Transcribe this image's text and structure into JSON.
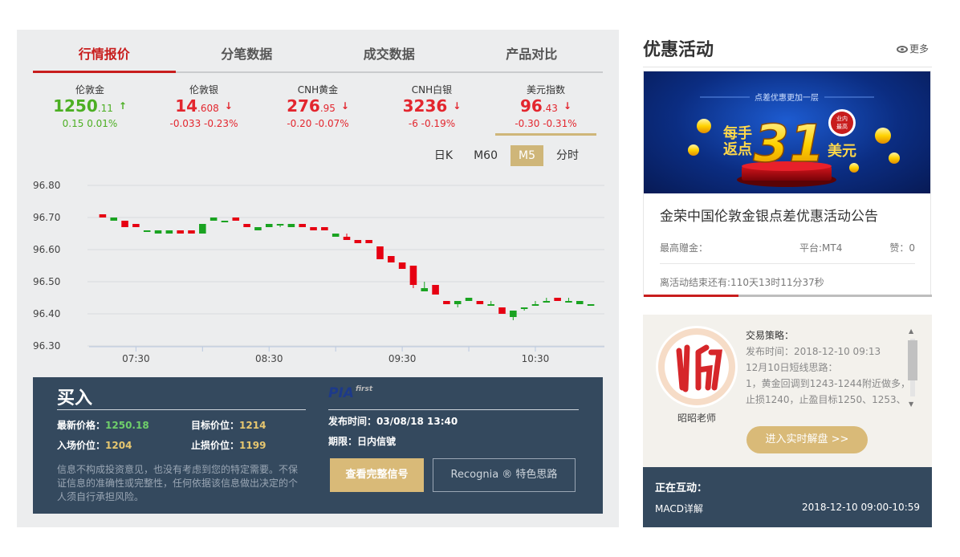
{
  "tabs": [
    "行情报价",
    "分笔数据",
    "成交数据",
    "产品对比"
  ],
  "quotes": [
    {
      "name": "伦敦金",
      "price_int": "1250",
      "price_dec": ".11",
      "arrow": "↑",
      "change": "0.15  0.01%",
      "dir": "up"
    },
    {
      "name": "伦敦银",
      "price_int": "14",
      "price_dec": ".608",
      "arrow": "↓",
      "change": "-0.033  -0.23%",
      "dir": "down"
    },
    {
      "name": "CNH黄金",
      "price_int": "276",
      "price_dec": ".95",
      "arrow": "↓",
      "change": "-0.20  -0.07%",
      "dir": "down"
    },
    {
      "name": "CNH白银",
      "price_int": "3236",
      "price_dec": "",
      "arrow": "↓",
      "change": "-6  -0.19%",
      "dir": "down"
    },
    {
      "name": "美元指数",
      "price_int": "96",
      "price_dec": ".43",
      "arrow": "↓",
      "change": "-0.30  -0.31%",
      "dir": "down"
    }
  ],
  "periods": [
    "日K",
    "M60",
    "M5",
    "分时"
  ],
  "active_period": "M5",
  "chart_data": {
    "type": "candlestick",
    "title": "",
    "ylim": [
      96.3,
      96.8
    ],
    "yticks": [
      "96.80",
      "96.70",
      "96.60",
      "96.50",
      "96.40",
      "96.30"
    ],
    "xticks": [
      "07:30",
      "08:30",
      "09:30",
      "10:30"
    ],
    "up_color": "#1aa321",
    "down_color": "#e60012",
    "candles": [
      {
        "o": 96.71,
        "c": 96.7,
        "h": 96.71,
        "l": 96.7
      },
      {
        "o": 96.69,
        "c": 96.7,
        "h": 96.7,
        "l": 96.69
      },
      {
        "o": 96.69,
        "c": 96.67,
        "h": 96.69,
        "l": 96.67
      },
      {
        "o": 96.68,
        "c": 96.67,
        "h": 96.68,
        "l": 96.67
      },
      {
        "o": 96.66,
        "c": 96.66,
        "h": 96.66,
        "l": 96.66
      },
      {
        "o": 96.65,
        "c": 96.66,
        "h": 96.66,
        "l": 96.65
      },
      {
        "o": 96.65,
        "c": 96.66,
        "h": 96.66,
        "l": 96.65
      },
      {
        "o": 96.66,
        "c": 96.65,
        "h": 96.66,
        "l": 96.65
      },
      {
        "o": 96.66,
        "c": 96.65,
        "h": 96.66,
        "l": 96.65
      },
      {
        "o": 96.65,
        "c": 96.68,
        "h": 96.68,
        "l": 96.65
      },
      {
        "o": 96.69,
        "c": 96.7,
        "h": 96.7,
        "l": 96.69
      },
      {
        "o": 96.69,
        "c": 96.69,
        "h": 96.69,
        "l": 96.69
      },
      {
        "o": 96.7,
        "c": 96.69,
        "h": 96.7,
        "l": 96.69
      },
      {
        "o": 96.68,
        "c": 96.67,
        "h": 96.68,
        "l": 96.67
      },
      {
        "o": 96.66,
        "c": 96.67,
        "h": 96.67,
        "l": 96.66
      },
      {
        "o": 96.67,
        "c": 96.68,
        "h": 96.68,
        "l": 96.67
      },
      {
        "o": 96.68,
        "c": 96.68,
        "h": 96.68,
        "l": 96.67
      },
      {
        "o": 96.67,
        "c": 96.68,
        "h": 96.68,
        "l": 96.67
      },
      {
        "o": 96.68,
        "c": 96.67,
        "h": 96.68,
        "l": 96.67
      },
      {
        "o": 96.67,
        "c": 96.66,
        "h": 96.67,
        "l": 96.66
      },
      {
        "o": 96.67,
        "c": 96.66,
        "h": 96.67,
        "l": 96.66
      },
      {
        "o": 96.64,
        "c": 96.65,
        "h": 96.65,
        "l": 96.64
      },
      {
        "o": 96.64,
        "c": 96.63,
        "h": 96.65,
        "l": 96.63
      },
      {
        "o": 96.63,
        "c": 96.62,
        "h": 96.63,
        "l": 96.62
      },
      {
        "o": 96.63,
        "c": 96.62,
        "h": 96.63,
        "l": 96.62
      },
      {
        "o": 96.61,
        "c": 96.57,
        "h": 96.61,
        "l": 96.57
      },
      {
        "o": 96.58,
        "c": 96.56,
        "h": 96.58,
        "l": 96.56
      },
      {
        "o": 96.56,
        "c": 96.54,
        "h": 96.56,
        "l": 96.54
      },
      {
        "o": 96.55,
        "c": 96.49,
        "h": 96.55,
        "l": 96.48
      },
      {
        "o": 96.47,
        "c": 96.48,
        "h": 96.5,
        "l": 96.47
      },
      {
        "o": 96.49,
        "c": 96.46,
        "h": 96.49,
        "l": 96.46
      },
      {
        "o": 96.44,
        "c": 96.43,
        "h": 96.44,
        "l": 96.43
      },
      {
        "o": 96.43,
        "c": 96.44,
        "h": 96.44,
        "l": 96.42
      },
      {
        "o": 96.44,
        "c": 96.45,
        "h": 96.45,
        "l": 96.44
      },
      {
        "o": 96.44,
        "c": 96.43,
        "h": 96.44,
        "l": 96.43
      },
      {
        "o": 96.43,
        "c": 96.43,
        "h": 96.44,
        "l": 96.43
      },
      {
        "o": 96.42,
        "c": 96.4,
        "h": 96.42,
        "l": 96.4
      },
      {
        "o": 96.39,
        "c": 96.41,
        "h": 96.41,
        "l": 96.38
      },
      {
        "o": 96.42,
        "c": 96.42,
        "h": 96.42,
        "l": 96.41
      },
      {
        "o": 96.43,
        "c": 96.43,
        "h": 96.44,
        "l": 96.43
      },
      {
        "o": 96.44,
        "c": 96.44,
        "h": 96.45,
        "l": 96.44
      },
      {
        "o": 96.45,
        "c": 96.44,
        "h": 96.45,
        "l": 96.44
      },
      {
        "o": 96.44,
        "c": 96.44,
        "h": 96.45,
        "l": 96.44
      },
      {
        "o": 96.43,
        "c": 96.44,
        "h": 96.44,
        "l": 96.43
      },
      {
        "o": 96.43,
        "c": 96.43,
        "h": 96.43,
        "l": 96.43
      }
    ]
  },
  "signal": {
    "title": "买入",
    "latest_label": "最新价格：",
    "latest_value": "1250.18",
    "target_label": "目标价位：",
    "target_value": "1214",
    "entry_label": "入场价位：",
    "entry_value": "1204",
    "stop_label": "止损价位：",
    "stop_value": "1199",
    "disclaimer": "信息不构成投资意见，也没有考虑到您的特定需要。不保证信息的准确性或完整性，任何依据该信息做出决定的个人须自行承担风险。",
    "logo_text": "PIA",
    "logo_sub": "first",
    "publish_label": "发布时间：",
    "publish_value": "03/08/18 13:40",
    "period_label": "期限：",
    "period_value": "日内信號",
    "btn_full": "查看完整信号",
    "btn_recognia": "Recognia ® 特色思路"
  },
  "promo": {
    "title": "优惠活动",
    "more": "更多",
    "banner": {
      "top_text": "点差优惠更加一层",
      "left_line1": "每手",
      "left_line2": "返点",
      "number": "31",
      "unit": "美元",
      "badge_line1": "业内",
      "badge_line2": "最高"
    },
    "card_title": "金荣中国伦敦金银点差优惠活动公告",
    "max_gift_label": "最高赠金：",
    "platform": "平台:MT4",
    "likes": "赞：0",
    "countdown": "离活动结束还有:110天13时11分37秒",
    "progress": 0.33,
    "progress_color": "#c81d1d"
  },
  "teacher": {
    "avatar_text": "昭",
    "name": "昭昭老师",
    "strategy_label": "交易策略：",
    "lines": [
      "发布时间：2018-12-10 09:13",
      "12月10日短线思路：",
      "1，黄金回调到1243-1244附近做多，",
      "止损1240，止盈目标1250、1253、"
    ],
    "btn_live": "进入实时解盘 >>"
  },
  "interact": {
    "title": "正在互动：",
    "topic": "MACD详解",
    "time": "2018-12-10 09:00-10:59"
  }
}
